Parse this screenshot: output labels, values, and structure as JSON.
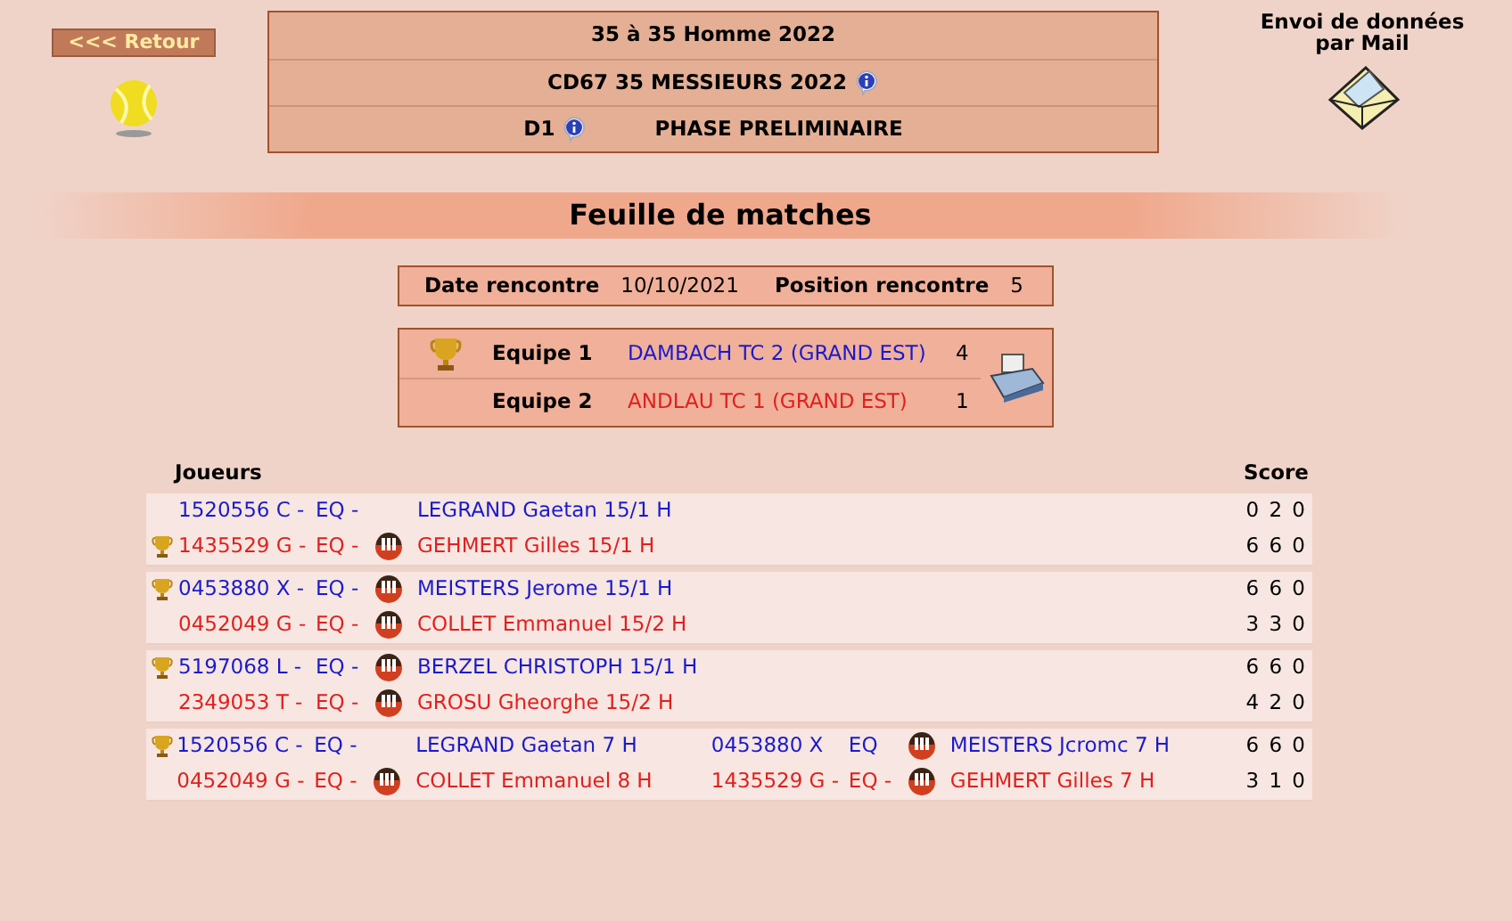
{
  "back_button": "<<< Retour",
  "header": {
    "line_1": "35  à 35  Homme  2022",
    "line_2": "CD67 35 MESSIEURS 2022",
    "division": "D1",
    "phase": "PHASE PRELIMINAIRE"
  },
  "mail": {
    "label": "Envoi de données par Mail"
  },
  "title": "Feuille de matches",
  "info": [
    {
      "label": "Date rencontre",
      "value": "10/10/2021"
    },
    {
      "label": "Position rencontre",
      "value": "5"
    }
  ],
  "teams": [
    {
      "label": "Equipe 1",
      "name": "DAMBACH TC 2 (GRAND EST)",
      "score": "4",
      "color": "#1a1acc",
      "winner": true
    },
    {
      "label": "Equipe 2",
      "name": "ANDLAU TC 1 (GRAND EST)",
      "score": "1",
      "color": "#e0201e",
      "winner": false
    }
  ],
  "table": {
    "columns": [
      "Joueurs",
      "Score"
    ],
    "matches": [
      {
        "rows": [
          {
            "color": "#1a1acc",
            "winner": false,
            "players": [
              {
                "licence": "1520556 C -",
                "eq": "EQ -",
                "jiff": false,
                "name": "LEGRAND  Gaetan  15/1 H"
              }
            ],
            "score": "0 2 0"
          },
          {
            "color": "#e0201e",
            "winner": true,
            "players": [
              {
                "licence": "1435529 G -",
                "eq": "EQ -",
                "jiff": true,
                "name": "GEHMERT  Gilles 15/1 H"
              }
            ],
            "score": "6 6 0"
          }
        ]
      },
      {
        "rows": [
          {
            "color": "#1a1acc",
            "winner": true,
            "players": [
              {
                "licence": "0453880 X -",
                "eq": "EQ -",
                "jiff": true,
                "name": "MEISTERS  Jerome  15/1 H"
              }
            ],
            "score": "6 6 0"
          },
          {
            "color": "#e0201e",
            "winner": false,
            "players": [
              {
                "licence": "0452049 G -",
                "eq": "EQ -",
                "jiff": true,
                "name": "COLLET  Emmanuel 15/2 H"
              }
            ],
            "score": "3 3 0"
          }
        ]
      },
      {
        "rows": [
          {
            "color": "#1a1acc",
            "winner": true,
            "players": [
              {
                "licence": "5197068 L -",
                "eq": "EQ -",
                "jiff": true,
                "name": "BERZEL  CHRISTOPH  15/1 H"
              }
            ],
            "score": "6 6 0"
          },
          {
            "color": "#e0201e",
            "winner": false,
            "players": [
              {
                "licence": "2349053 T -",
                "eq": "EQ -",
                "jiff": true,
                "name": "GROSU  Gheorghe 15/2 H"
              }
            ],
            "score": "4 2 0"
          }
        ]
      },
      {
        "rows": [
          {
            "color": "#1a1acc",
            "winner": true,
            "players": [
              {
                "licence": "1520556 C -",
                "eq": "EQ -",
                "jiff": false,
                "name": "LEGRAND  Gaetan  7 H"
              },
              {
                "licence": "0453880 X",
                "eq": "EQ",
                "jiff": true,
                "name": "MEISTERS  Jcromc  7 H"
              }
            ],
            "score": "6 6 0"
          },
          {
            "color": "#e0201e",
            "winner": false,
            "players": [
              {
                "licence": "0452049 G -",
                "eq": "EQ -",
                "jiff": true,
                "name": "COLLET  Emmanuel 8 H"
              },
              {
                "licence": "1435529 G -",
                "eq": "EQ -",
                "jiff": true,
                "name": "GEHMERT  Gilles 7 H"
              }
            ],
            "score": "3 1 0"
          }
        ]
      }
    ]
  }
}
